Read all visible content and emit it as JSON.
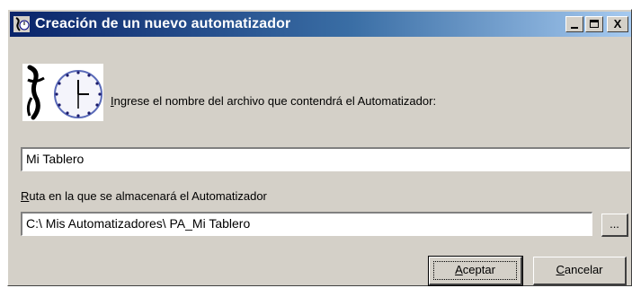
{
  "window": {
    "title": "Creación de un nuevo automatizador",
    "icon": "automatizador-app-icon",
    "controls": {
      "minimize": "minimize-icon",
      "maximize": "maximize-icon",
      "close_label": "X"
    }
  },
  "main": {
    "icon": "automatizador-clock-icon",
    "prompt": {
      "first_letter": "I",
      "rest": "ngrese el nombre del archivo que contendrá el Automatizador:"
    },
    "name_field": {
      "value": "Mi Tablero"
    },
    "path_label": {
      "first_letter": "R",
      "rest": "uta en la que se almacenará el Automatizador"
    },
    "path_field": {
      "value": "C:\\ Mis Automatizadores\\ PA_Mi Tablero"
    },
    "browse_label": "..."
  },
  "buttons": {
    "accept": {
      "first_letter": "A",
      "rest": "ceptar"
    },
    "cancel": {
      "first_letter": "C",
      "rest": "ancelar"
    }
  },
  "colors": {
    "titlebar_start": "#0a246a",
    "titlebar_end": "#a6caf0",
    "dialog_face": "#d4d0c8"
  }
}
